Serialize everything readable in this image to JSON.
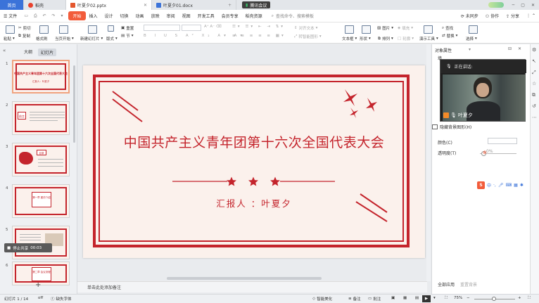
{
  "tabs": {
    "home": "首页",
    "docer": "稻壳",
    "file1": "叶夏夕02.pptx",
    "file2": "叶夏夕01.docx",
    "center_badge": "腾讯会议",
    "login": "登录"
  },
  "menu": {
    "file": "文件",
    "items": [
      "开始",
      "插入",
      "设计",
      "切换",
      "动画",
      "放映",
      "审阅",
      "视图",
      "开发工具",
      "会员专享",
      "稻壳资源"
    ],
    "search": "查找命令、搜索模板",
    "sync": "未同步",
    "collab": "协作",
    "share": "分享"
  },
  "ribbon": {
    "paste": "粘贴",
    "cut": "剪切",
    "copy": "复制",
    "format_painter": "格式刷",
    "from_current": "当页开始",
    "new_slide": "新建幻灯片",
    "layout": "版式",
    "section": "节",
    "reset": "重置",
    "text_align": "对齐文本",
    "convert_smartart": "转智能图形",
    "text_box": "文本框",
    "shapes": "形状",
    "arrange": "排列",
    "picture": "图片",
    "fill": "填充",
    "outline": "轮廓",
    "presenter_tools": "演示工具",
    "find": "查找",
    "replace": "替换",
    "select": "选择"
  },
  "left_panel": {
    "tab_outline": "大纲",
    "tab_slides": "幻灯片",
    "thumbs": [
      {
        "num": "1",
        "title": "中国共产主义青年团第十六次全国代表大会",
        "sub": "汇报人：叶夏夕"
      },
      {
        "num": "2",
        "title": "前言",
        "sub": ""
      },
      {
        "num": "3",
        "title": "目录",
        "sub": ""
      },
      {
        "num": "4",
        "title": "第一章 团史介绍",
        "sub": ""
      },
      {
        "num": "5",
        "title": "",
        "sub": ""
      },
      {
        "num": "6",
        "title": "第二章 会议流程",
        "sub": ""
      }
    ]
  },
  "slide": {
    "title": "中国共产主义青年团第十六次全国代表大会",
    "reporter": "汇报人 ：叶夏夕"
  },
  "notes": {
    "placeholder": "单击此处添加备注"
  },
  "right_panel": {
    "title": "对象属性",
    "fill_label": "填",
    "hide_bg": "隐藏背景图形(H)",
    "color_label": "颜色(C)",
    "transparency_label": "透明度(T)",
    "transparency_value": "0%",
    "apply_all": "全部应用",
    "reset_bg": "重置背景",
    "video_status": "正在讲话:",
    "video_name": "叶夏夕"
  },
  "ime": {
    "label": "中"
  },
  "recording": {
    "label": "停止共享",
    "timer": "00:03"
  },
  "status_bar": {
    "slide_info": "幻灯片 1 / 14",
    "theme": "off",
    "missing_font": "缺失字体",
    "smart_beautify": "智能美化",
    "notes": "备注",
    "comments": "批注",
    "zoom": "75%"
  },
  "colors": {
    "accent": "#c4242c",
    "start_tab": "#f25c3b",
    "slide_bg": "#fbf1ec"
  }
}
